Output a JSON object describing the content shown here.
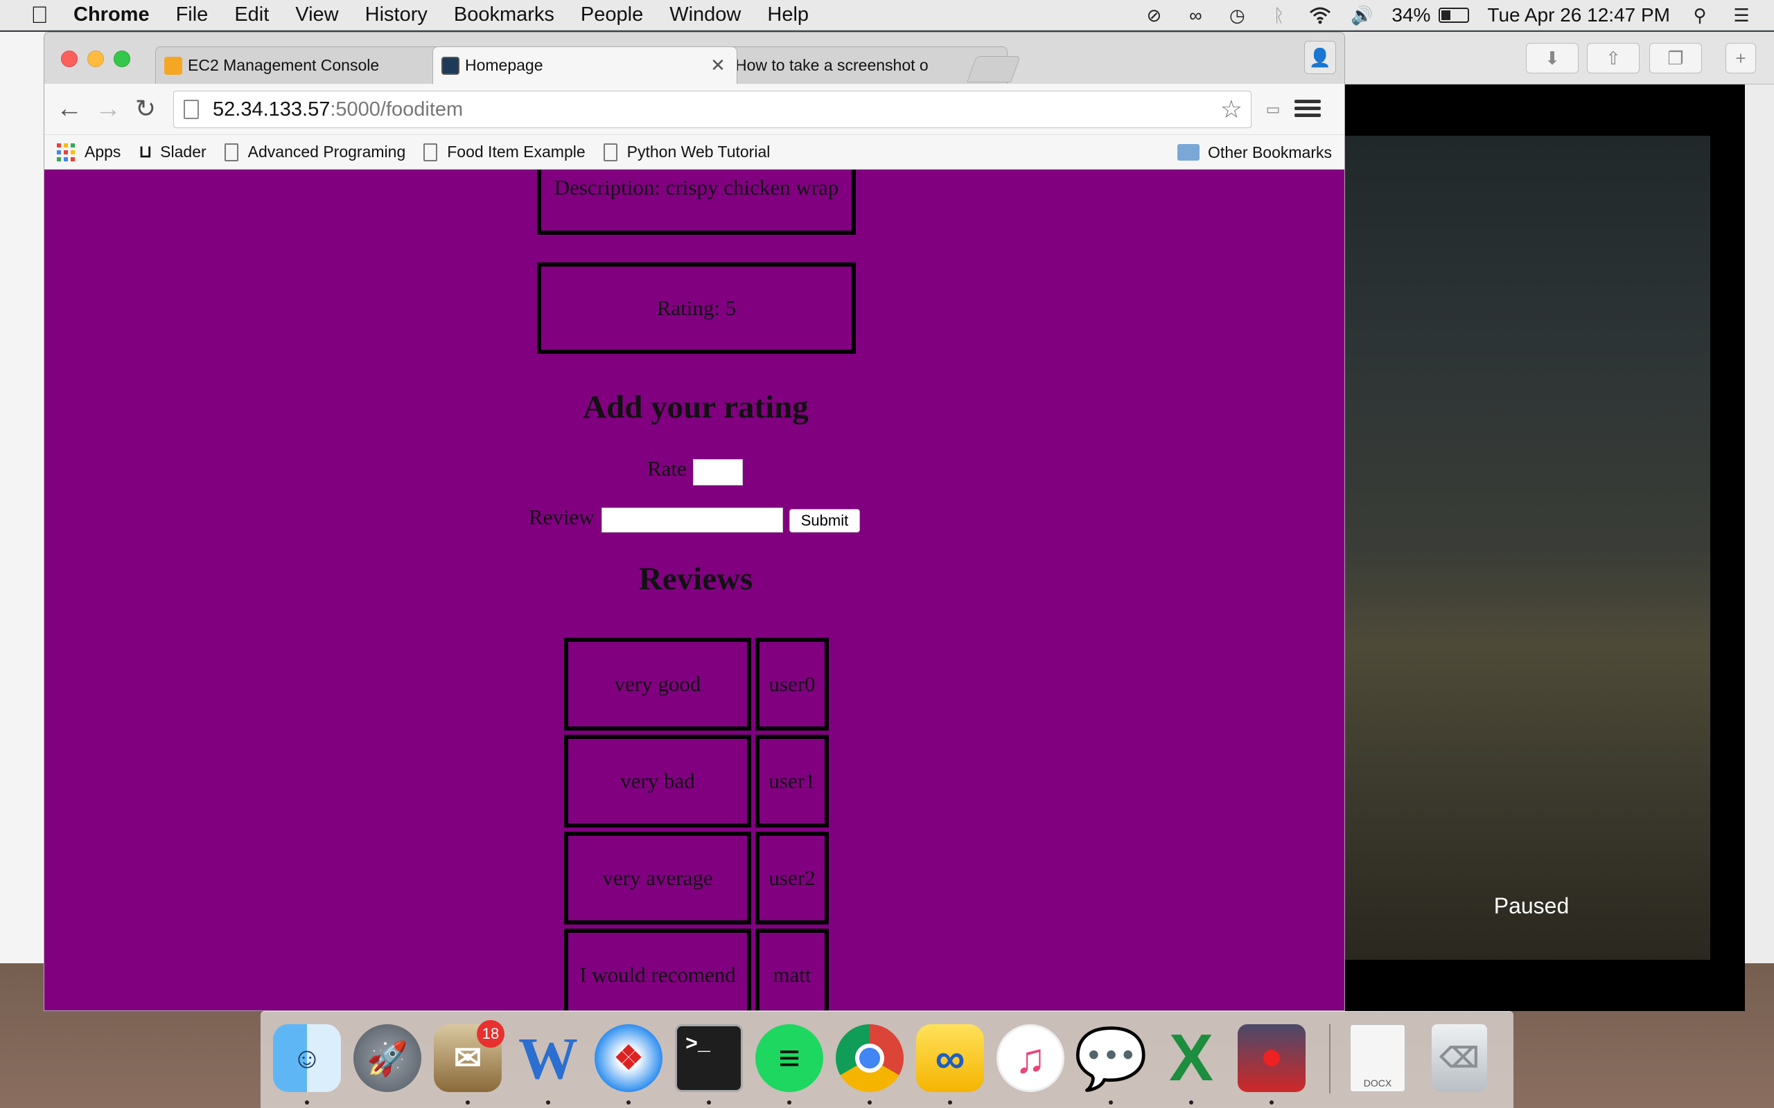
{
  "menubar": {
    "app_name": "Chrome",
    "items": [
      "File",
      "Edit",
      "View",
      "History",
      "Bookmarks",
      "People",
      "Window",
      "Help"
    ],
    "battery_percent": "34%",
    "datetime": "Tue Apr 26  12:47 PM"
  },
  "chrome": {
    "tabs": [
      {
        "label": "EC2 Management Console",
        "active": false
      },
      {
        "label": "Homepage",
        "active": true
      },
      {
        "label": "How to take a screenshot o",
        "active": false
      }
    ],
    "url": {
      "host": "52.34.133.57",
      "path": ":5000/fooditem"
    },
    "bookmarks": [
      "Apps",
      "Slader",
      "Advanced Programing",
      "Food Item Example",
      "Python Web Tutorial"
    ],
    "other_bookmarks": "Other Bookmarks"
  },
  "page": {
    "description": "Description: crispy chicken wrap",
    "rating": "Rating: 5",
    "add_rating_heading": "Add your rating",
    "rate_label": "Rate",
    "review_label": "Review",
    "submit_label": "Submit",
    "reviews_heading": "Reviews",
    "reviews": [
      {
        "text": "very good",
        "user": "user0"
      },
      {
        "text": "very bad",
        "user": "user1"
      },
      {
        "text": "very average",
        "user": "user2"
      },
      {
        "text": "I would recomend",
        "user": "matt"
      }
    ]
  },
  "video": {
    "status": "Paused"
  },
  "dock": {
    "mail_badge": "18",
    "apps": [
      "Finder",
      "Launchpad",
      "Mail",
      "Word",
      "Safari",
      "Terminal",
      "Spotify",
      "Chrome",
      "Fetch",
      "iTunes",
      "Messages",
      "Excel",
      "Joystick",
      "Document",
      "Trash"
    ],
    "doc_label": "DOCX"
  },
  "colors": {
    "page_background": "#800080",
    "menubar": "#e9e9e9"
  }
}
